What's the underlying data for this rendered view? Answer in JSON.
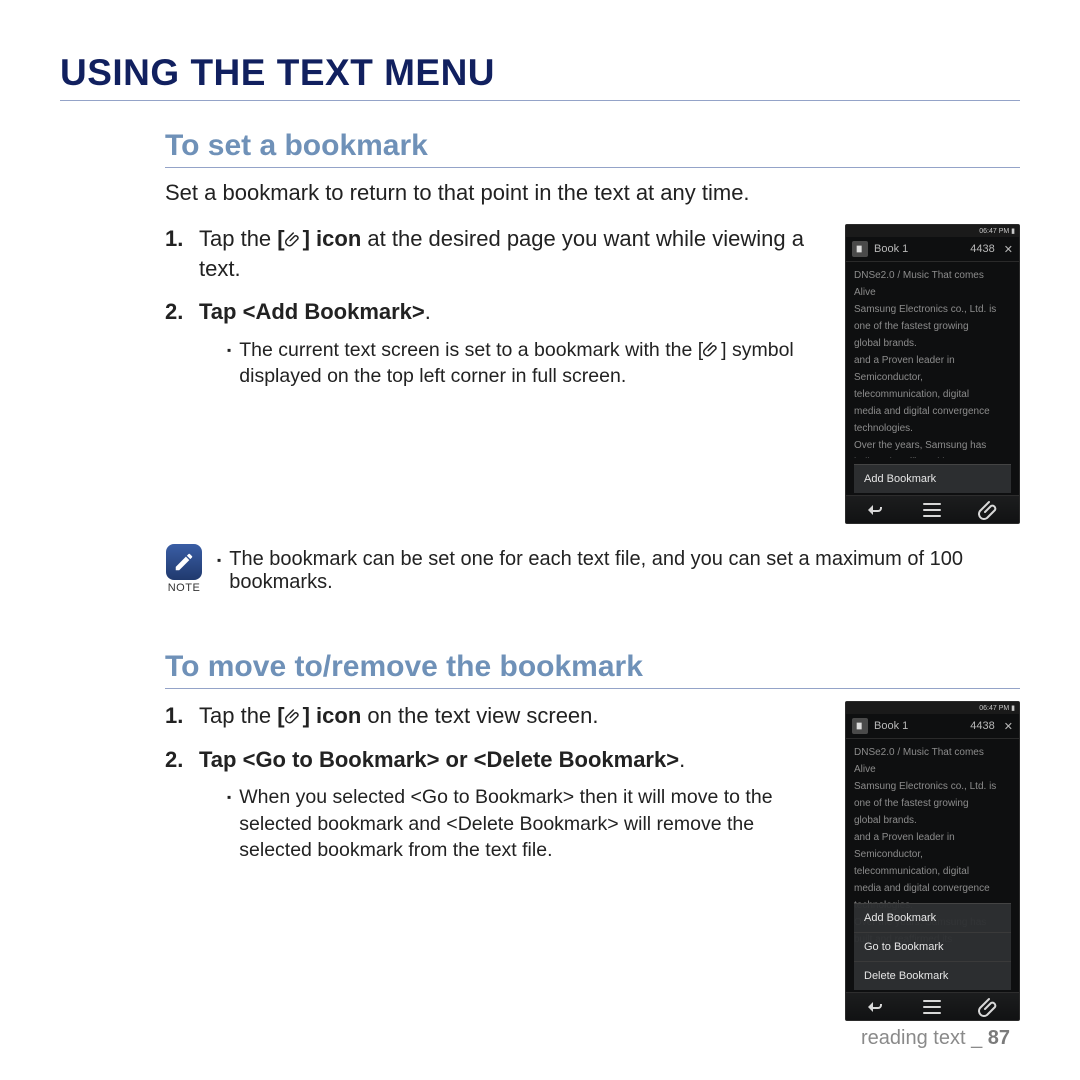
{
  "page_title": "USING THE TEXT MENU",
  "section1": {
    "title": "To set a bookmark",
    "intro": "Set a bookmark to return to that point in the text at any time.",
    "step1_prefix": "Tap the ",
    "step1_bold": "[",
    "step1_bold2": "] icon",
    "step1_suffix": " at the desired page you want while viewing a text.",
    "step2_prefix": "Tap ",
    "step2_bold": "<Add Bookmark>",
    "step2_suffix": ".",
    "bullet1_a": "The current text screen is set to a bookmark with the [",
    "bullet1_b": "] symbol displayed on the top left corner in full screen."
  },
  "note": {
    "label": "NOTE",
    "text": "The bookmark can be set one for each text file, and you can set a maximum of 100 bookmarks."
  },
  "section2": {
    "title": "To move to/remove the bookmark",
    "step1_prefix": "Tap the ",
    "step1_bold": "[",
    "step1_bold2": "] icon",
    "step1_suffix": " on the text view screen.",
    "step2_prefix": "Tap ",
    "step2_bold": "<Go to Bookmark> or <Delete Bookmark>",
    "step2_suffix": ".",
    "bullet1": "When you selected <Go to Bookmark> then it will move to the selected bookmark and <Delete Bookmark> will remove the selected bookmark from the text file."
  },
  "phone": {
    "status_time": "06:47 PM",
    "title": "Book 1",
    "counter": "4438",
    "lines": [
      "DNSe2.0 / Music That comes",
      "Alive",
      "Samsung Electronics co., Ltd. is",
      "one of the fastest growing",
      "global brands.",
      "and a Proven leader in",
      "Semiconductor,",
      "telecommunication, digital",
      "media and digital convergence",
      "technologies.",
      "Over the years, Samsung has",
      "built and reaffirmed its"
    ],
    "menu1": [
      "Add Bookmark"
    ],
    "menu2": [
      "Add Bookmark",
      "Go to Bookmark",
      "Delete Bookmark"
    ]
  },
  "footer": {
    "section": "reading text",
    "sep": "_",
    "page": "87"
  }
}
